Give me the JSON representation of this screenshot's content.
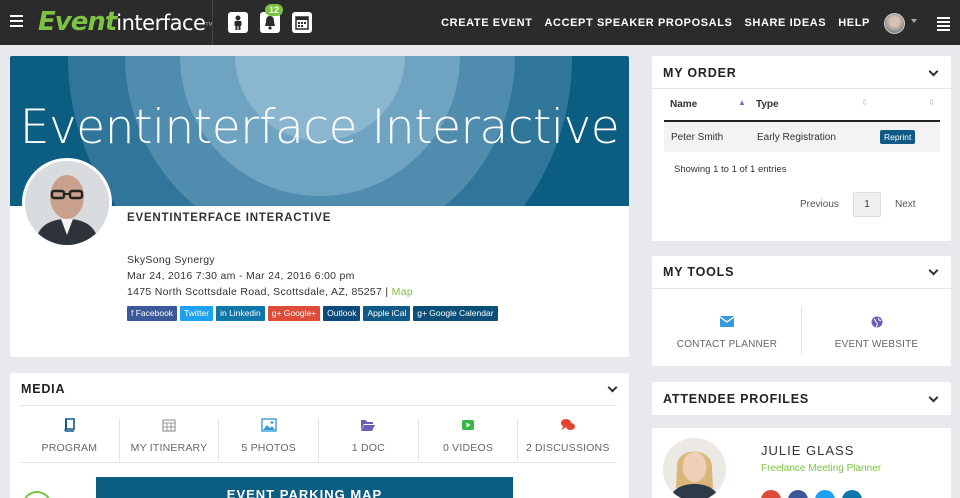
{
  "nav": {
    "logo_script": "Event",
    "logo_text": "interface",
    "logo_tm": "TM",
    "notification_count": "12",
    "links": [
      "CREATE EVENT",
      "ACCEPT SPEAKER PROPOSALS",
      "SHARE IDEAS",
      "HELP"
    ]
  },
  "event": {
    "banner_title": "Eventinterface Interactive",
    "name": "EVENTINTERFACE INTERACTIVE",
    "venue": "SkySong Synergy",
    "dates": "Mar 24, 2016 7:30 am - Mar 24, 2016 6:00 pm",
    "address": "1475 North Scottsdale Road, Scottsdale, AZ, 85257 |",
    "map_link": "Map",
    "share": [
      {
        "label": "f Facebook",
        "color": "#3b5998"
      },
      {
        "label": "Twitter",
        "color": "#1da1f2"
      },
      {
        "label": "in Linkedin",
        "color": "#0e76a8"
      },
      {
        "label": "g+ Google+",
        "color": "#dd4b39"
      },
      {
        "label": "Outlook",
        "color": "#0b4a7a"
      },
      {
        "label": "Apple iCal",
        "color": "#0e5a86"
      },
      {
        "label": "g+ Google Calendar",
        "color": "#0b4f79"
      }
    ]
  },
  "media": {
    "title": "MEDIA",
    "items": [
      "PROGRAM",
      "MY ITINERARY",
      "5 PHOTOS",
      "1 DOC",
      "0 VIDEOS",
      "2 DISCUSSIONS"
    ],
    "parking_title": "EVENT PARKING MAP"
  },
  "order": {
    "title": "MY ORDER",
    "columns": [
      "Name",
      "Type"
    ],
    "row": {
      "name": "Peter Smith",
      "type": "Early Registration",
      "action": "Reprint"
    },
    "summary": "Showing 1 to 1 of 1 entries",
    "prev": "Previous",
    "page": "1",
    "next": "Next"
  },
  "tools": {
    "title": "MY TOOLS",
    "items": [
      "CONTACT PLANNER",
      "EVENT WEBSITE"
    ]
  },
  "attendees": {
    "title": "ATTENDEE PROFILES",
    "name": "JULIE GLASS",
    "role": "Freelance Meeting Planner"
  },
  "colors": {
    "brand_green": "#7cc243",
    "brand_blue": "#0c5d82",
    "topbar": "#2b2b2b"
  }
}
